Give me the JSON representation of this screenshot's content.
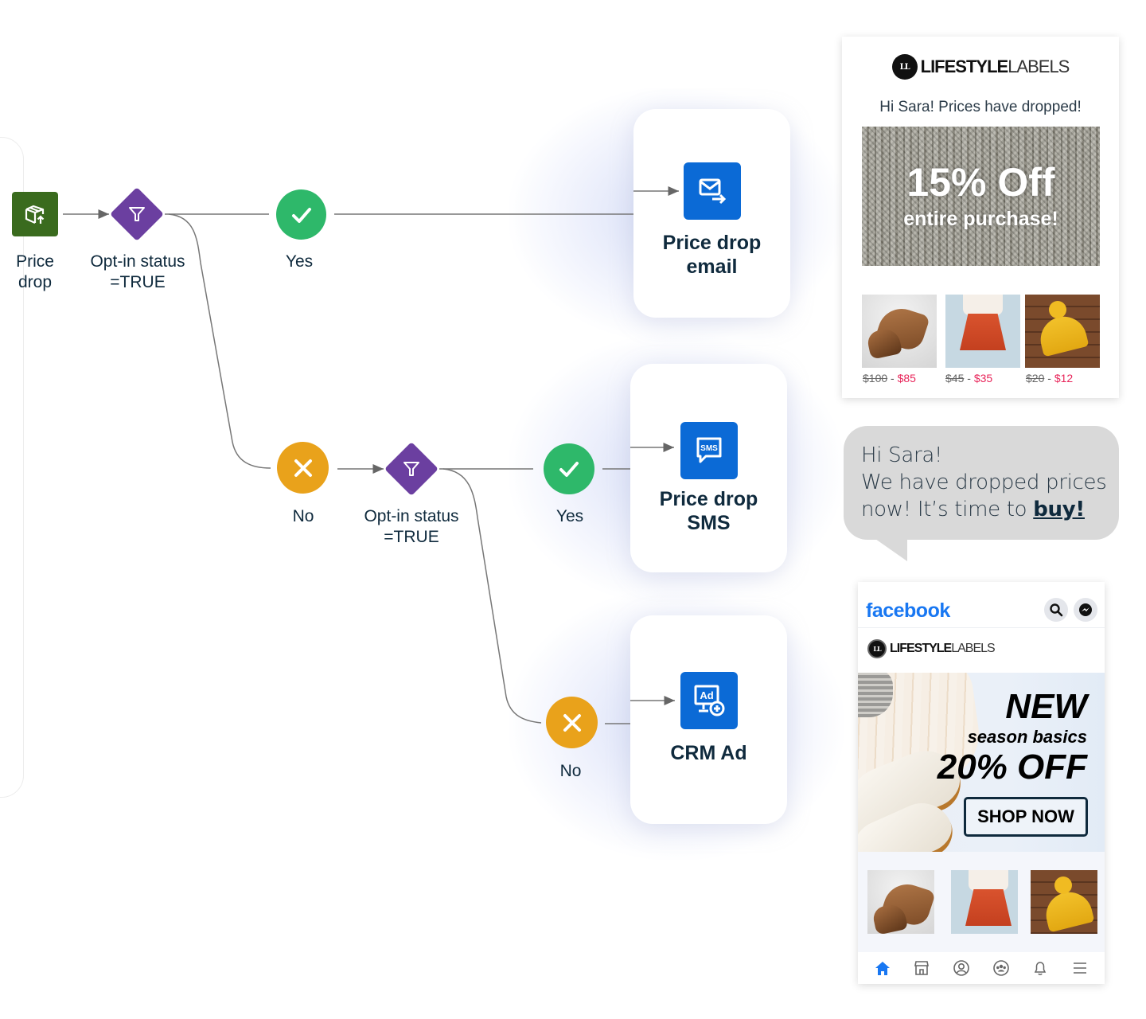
{
  "flow": {
    "trigger": {
      "label_line1": "Price",
      "label_line2": "drop",
      "icon": "box-arrow-up-icon",
      "color": "#3a6b1e"
    },
    "decision1": {
      "label_line1": "Opt-in status",
      "label_line2": "=TRUE",
      "icon": "filter-icon",
      "color": "#6b3fa0"
    },
    "yes1": {
      "label": "Yes",
      "icon": "check-icon",
      "color": "#2eb86a"
    },
    "no1": {
      "label": "No",
      "icon": "x-icon",
      "color": "#e9a21b"
    },
    "decision2": {
      "label_line1": "Opt-in status",
      "label_line2": "=TRUE",
      "icon": "filter-icon",
      "color": "#6b3fa0"
    },
    "yes2": {
      "label": "Yes",
      "icon": "check-icon",
      "color": "#2eb86a"
    },
    "no2": {
      "label": "No",
      "icon": "x-icon",
      "color": "#e9a21b"
    },
    "actions": [
      {
        "title_line1": "Price drop",
        "title_line2": "email",
        "icon": "email-send-icon"
      },
      {
        "title_line1": "Price drop",
        "title_line2": "SMS",
        "icon": "sms-icon",
        "icon_text": "SMS"
      },
      {
        "title_line1": "CRM Ad",
        "title_line2": "",
        "icon": "ad-add-icon",
        "icon_text": "Ad"
      }
    ],
    "action_color": "#0b6ad6"
  },
  "email_preview": {
    "brand_bold": "LIFESTYLE",
    "brand_light": "LABELS",
    "logo_mark": "LL",
    "greeting": "Hi Sara! Prices have dropped!",
    "hero_line1": "15% Off",
    "hero_line2": "entire purchase!",
    "products": [
      {
        "name": "boots",
        "old_price": "$100",
        "sep": " - ",
        "new_price": "$85"
      },
      {
        "name": "skirt",
        "old_price": "$45",
        "sep": " - ",
        "new_price": "$35"
      },
      {
        "name": "beanie",
        "old_price": "$20",
        "sep": " - ",
        "new_price": "$12"
      }
    ],
    "sale_color": "#e8255a"
  },
  "sms_preview": {
    "line1": "Hi Sara!",
    "line2": "We have dropped prices",
    "line3": "now! It’s time to ",
    "link": "buy!"
  },
  "facebook_ad": {
    "app_name": "facebook",
    "brand_bold": "LIFESTYLE",
    "brand_light": "LABELS",
    "logo_mark": "LL",
    "headline1": "NEW",
    "headline2": "season basics",
    "headline3": "20% OFF",
    "cta": "SHOP NOW",
    "nav": [
      "home",
      "marketplace",
      "profile",
      "groups",
      "notifications",
      "menu"
    ],
    "brand_color": "#1877f2"
  }
}
